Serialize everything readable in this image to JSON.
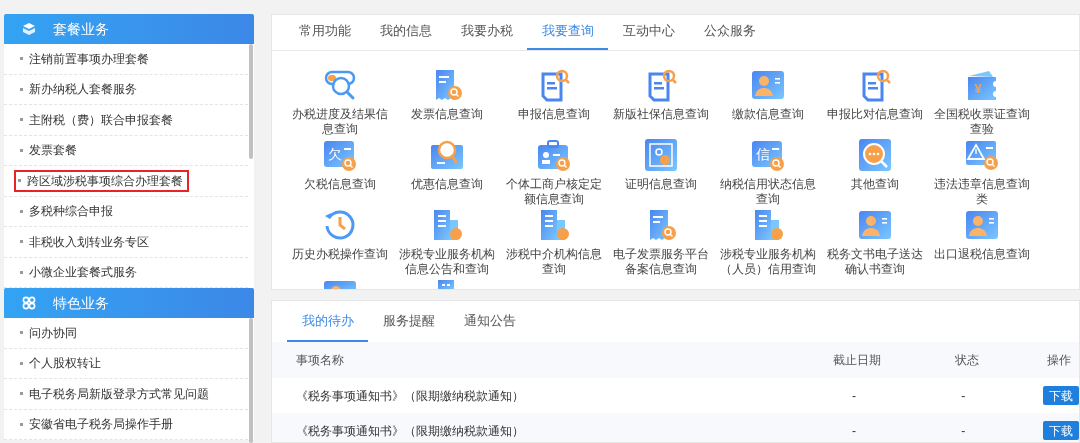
{
  "sidebar": {
    "groups": [
      {
        "title": "套餐业务",
        "items": [
          {
            "label": "注销前置事项办理套餐",
            "marked": false
          },
          {
            "label": "新办纳税人套餐服务",
            "marked": false
          },
          {
            "label": "主附税（费）联合申报套餐",
            "marked": false
          },
          {
            "label": "发票套餐",
            "marked": false
          },
          {
            "label": "跨区域涉税事项综合办理套餐",
            "marked": true
          },
          {
            "label": "多税种综合申报",
            "marked": false
          },
          {
            "label": "非税收入划转业务专区",
            "marked": false
          },
          {
            "label": "小微企业套餐式服务",
            "marked": false
          }
        ]
      },
      {
        "title": "特色业务",
        "items": [
          {
            "label": "问办协同",
            "marked": false
          },
          {
            "label": "个人股权转让",
            "marked": false
          },
          {
            "label": "电子税务局新版登录方式常见问题",
            "marked": false
          },
          {
            "label": "安徽省电子税务局操作手册",
            "marked": false
          }
        ]
      }
    ]
  },
  "function_panel": {
    "tabs": [
      {
        "label": "常用功能",
        "selected": false
      },
      {
        "label": "我的信息",
        "selected": false
      },
      {
        "label": "我要办税",
        "selected": false
      },
      {
        "label": "我要查询",
        "selected": true
      },
      {
        "label": "互动中心",
        "selected": false
      },
      {
        "label": "公众服务",
        "selected": false
      }
    ],
    "items": [
      {
        "label": "办税进度及结果信息查询",
        "kind": "toggle"
      },
      {
        "label": "发票信息查询",
        "kind": "doc"
      },
      {
        "label": "申报信息查询",
        "kind": "clip"
      },
      {
        "label": "新版社保信息查询",
        "kind": "clip"
      },
      {
        "label": "缴款信息查询",
        "kind": "person"
      },
      {
        "label": "申报比对信息查询",
        "kind": "clip"
      },
      {
        "label": "全国税收票证查询查验",
        "kind": "ticket",
        "glyph": "¥"
      },
      {
        "label": "欠税信息查询",
        "kind": "glyph",
        "glyph": "欠"
      },
      {
        "label": "优惠信息查询",
        "kind": "magnifier"
      },
      {
        "label": "个体工商户核定定额信息查询",
        "kind": "idcard"
      },
      {
        "label": "证明信息查询",
        "kind": "certificate"
      },
      {
        "label": "纳税信用状态信息查询",
        "kind": "glyph",
        "glyph": "信"
      },
      {
        "label": "其他查询",
        "kind": "ellipsis"
      },
      {
        "label": "违法违章信息查询类",
        "kind": "alert"
      },
      {
        "label": "历史办税操作查询",
        "kind": "history"
      },
      {
        "label": "涉税专业服务机构信息公告和查询",
        "kind": "building"
      },
      {
        "label": "涉税中介机构信息查询",
        "kind": "building"
      },
      {
        "label": "电子发票服务平台备案信息查询",
        "kind": "doc"
      },
      {
        "label": "涉税专业服务机构（人员）信用查询",
        "kind": "building"
      },
      {
        "label": "税务文书电子送达确认书查询",
        "kind": "person"
      },
      {
        "label": "出口退税信息查询",
        "kind": "person"
      },
      {
        "kind": "partial-person"
      },
      {
        "kind": "partial-building"
      }
    ]
  },
  "todo_panel": {
    "tabs": [
      {
        "label": "我的待办",
        "selected": true
      },
      {
        "label": "服务提醒",
        "selected": false
      },
      {
        "label": "通知公告",
        "selected": false
      }
    ],
    "columns": [
      "事项名称",
      "截止日期",
      "状态",
      "操作"
    ],
    "rows": [
      {
        "name": "《税务事项通知书》（限期缴纳税款通知）",
        "deadline": "-",
        "status": "-",
        "action": "下载"
      },
      {
        "name": "《税务事项通知书》（限期缴纳税款通知）",
        "deadline": "-",
        "status": "-",
        "action": "下载"
      }
    ]
  }
}
